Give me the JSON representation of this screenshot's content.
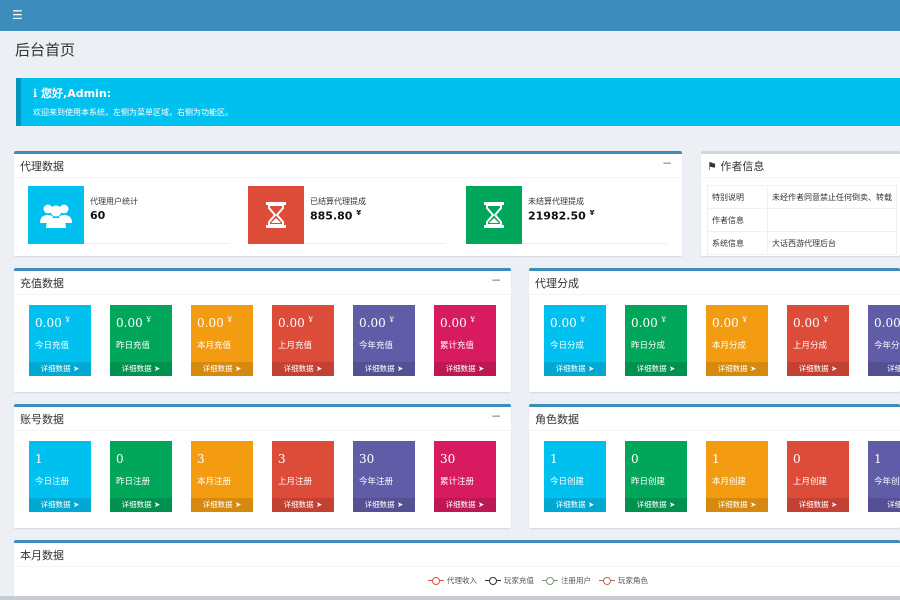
{
  "header": {
    "menu_icon": "hamburger-icon"
  },
  "page": {
    "title": "后台首页"
  },
  "callout": {
    "title": "您好,Admin:",
    "text": "欢迎来到使用本系统，左侧为菜单区域，右侧为功能区。",
    "icon": "info-icon"
  },
  "agent_box": {
    "title": "代理数据",
    "collapse": "−",
    "items": [
      {
        "label": "代理用户统计",
        "value": "60",
        "icon": "users-icon",
        "color": "#00c0ef"
      },
      {
        "label": "已结算代理提成",
        "value": "885.80",
        "unit": "¥",
        "icon": "hourglass-icon",
        "color": "#dd4b39"
      },
      {
        "label": "未结算代理提成",
        "value": "21982.50",
        "unit": "¥",
        "icon": "hourglass-icon",
        "color": "#00a65a"
      }
    ]
  },
  "author_box": {
    "title": "作者信息",
    "icon": "tag-icon",
    "rows": [
      {
        "key": "特别说明",
        "value": "未经作者同意禁止任何倒卖、转载"
      },
      {
        "key": "作者信息",
        "value": ""
      },
      {
        "key": "系统信息",
        "value": "大话西游代理后台"
      }
    ]
  },
  "recharge_box": {
    "title": "充值数据",
    "collapse": "−",
    "tiles": [
      {
        "value": "0.00",
        "unit": "¥",
        "label": "今日充值",
        "link": "详细数据",
        "color": "aqua"
      },
      {
        "value": "0.00",
        "unit": "¥",
        "label": "昨日充值",
        "link": "详细数据",
        "color": "green"
      },
      {
        "value": "0.00",
        "unit": "¥",
        "label": "本月充值",
        "link": "详细数据",
        "color": "orange"
      },
      {
        "value": "0.00",
        "unit": "¥",
        "label": "上月充值",
        "link": "详细数据",
        "color": "red"
      },
      {
        "value": "0.00",
        "unit": "¥",
        "label": "今年充值",
        "link": "详细数据",
        "color": "purple"
      },
      {
        "value": "0.00",
        "unit": "¥",
        "label": "累计充值",
        "link": "详细数据",
        "color": "maroon"
      }
    ]
  },
  "commission_box": {
    "title": "代理分成",
    "tiles": [
      {
        "value": "0.00",
        "unit": "¥",
        "label": "今日分成",
        "link": "详细数据",
        "color": "aqua"
      },
      {
        "value": "0.00",
        "unit": "¥",
        "label": "昨日分成",
        "link": "详细数据",
        "color": "green"
      },
      {
        "value": "0.00",
        "unit": "¥",
        "label": "本月分成",
        "link": "详细数据",
        "color": "orange"
      },
      {
        "value": "0.00",
        "unit": "¥",
        "label": "上月分成",
        "link": "详细数据",
        "color": "red"
      },
      {
        "value": "0.00",
        "unit": "",
        "label": "今年分",
        "link": "详细",
        "color": "purple"
      }
    ]
  },
  "account_box": {
    "title": "账号数据",
    "collapse": "−",
    "tiles": [
      {
        "value": "1",
        "unit": "",
        "label": "今日注册",
        "link": "详细数据",
        "color": "aqua"
      },
      {
        "value": "0",
        "unit": "",
        "label": "昨日注册",
        "link": "详细数据",
        "color": "green"
      },
      {
        "value": "3",
        "unit": "",
        "label": "本月注册",
        "link": "详细数据",
        "color": "orange"
      },
      {
        "value": "3",
        "unit": "",
        "label": "上月注册",
        "link": "详细数据",
        "color": "red"
      },
      {
        "value": "30",
        "unit": "",
        "label": "今年注册",
        "link": "详细数据",
        "color": "purple"
      },
      {
        "value": "30",
        "unit": "",
        "label": "累计注册",
        "link": "详细数据",
        "color": "maroon"
      }
    ]
  },
  "role_box": {
    "title": "角色数据",
    "tiles": [
      {
        "value": "1",
        "unit": "",
        "label": "今日创建",
        "link": "详细数据",
        "color": "aqua"
      },
      {
        "value": "0",
        "unit": "",
        "label": "昨日创建",
        "link": "详细数据",
        "color": "green"
      },
      {
        "value": "1",
        "unit": "",
        "label": "本月创建",
        "link": "详细数据",
        "color": "orange"
      },
      {
        "value": "0",
        "unit": "",
        "label": "上月创建",
        "link": "详细数据",
        "color": "red"
      },
      {
        "value": "1",
        "unit": "",
        "label": "今年创",
        "link": "详细",
        "color": "purple"
      }
    ]
  },
  "month_box": {
    "title": "本月数据",
    "legend": [
      {
        "name": "代理收入",
        "color": "#dd4b39"
      },
      {
        "name": "玩家充值",
        "color": "#333333"
      },
      {
        "name": "注册用户",
        "color": "#7a9a7a"
      },
      {
        "name": "玩家角色",
        "color": "#b07060"
      }
    ]
  }
}
